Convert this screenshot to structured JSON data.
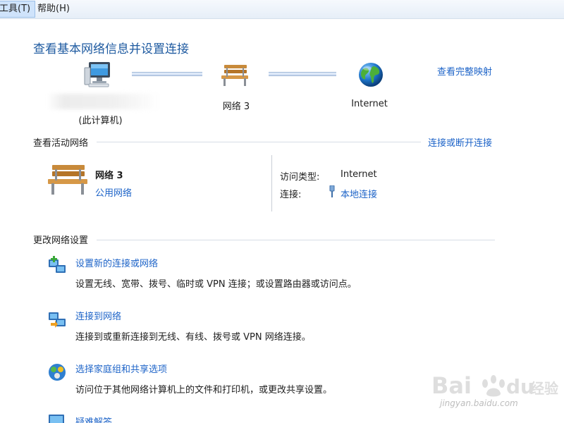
{
  "menu": {
    "tools": "工具(T)",
    "help": "帮助(H)"
  },
  "header": {
    "title": "查看基本网络信息并设置连接",
    "full_map_link": "查看完整映射"
  },
  "map": {
    "computer_label": "(此计算机)",
    "network_label": "网络  3",
    "internet_label": "Internet"
  },
  "active": {
    "section_title": "查看活动网络",
    "connect_link": "连接或断开连接",
    "network_name": "网络  3",
    "network_type": "公用网络",
    "access_type_key": "访问类型:",
    "access_type_val": "Internet",
    "connection_key": "连接:",
    "connection_val": "本地连接"
  },
  "change": {
    "section_title": "更改网络设置",
    "tasks": [
      {
        "title": "设置新的连接或网络",
        "desc": "设置无线、宽带、拨号、临时或 VPN 连接；或设置路由器或访问点。"
      },
      {
        "title": "连接到网络",
        "desc": "连接到或重新连接到无线、有线、拨号或 VPN 网络连接。"
      },
      {
        "title": "选择家庭组和共享选项",
        "desc": "访问位于其他网络计算机上的文件和打印机，或更改共享设置。"
      },
      {
        "title": "疑难解答"
      }
    ]
  },
  "watermark": {
    "brand": "Bai du 经验",
    "url": "jingyan.baidu.com"
  },
  "icons": [
    "computer-icon",
    "bench-icon",
    "globe-icon",
    "usb-plug-icon",
    "new-connection-icon",
    "connect-network-icon",
    "homegroup-icon",
    "troubleshoot-icon"
  ],
  "colors": {
    "link": "#1e64c8",
    "title": "#1e5aa0",
    "menubar": "#e6eef8"
  }
}
